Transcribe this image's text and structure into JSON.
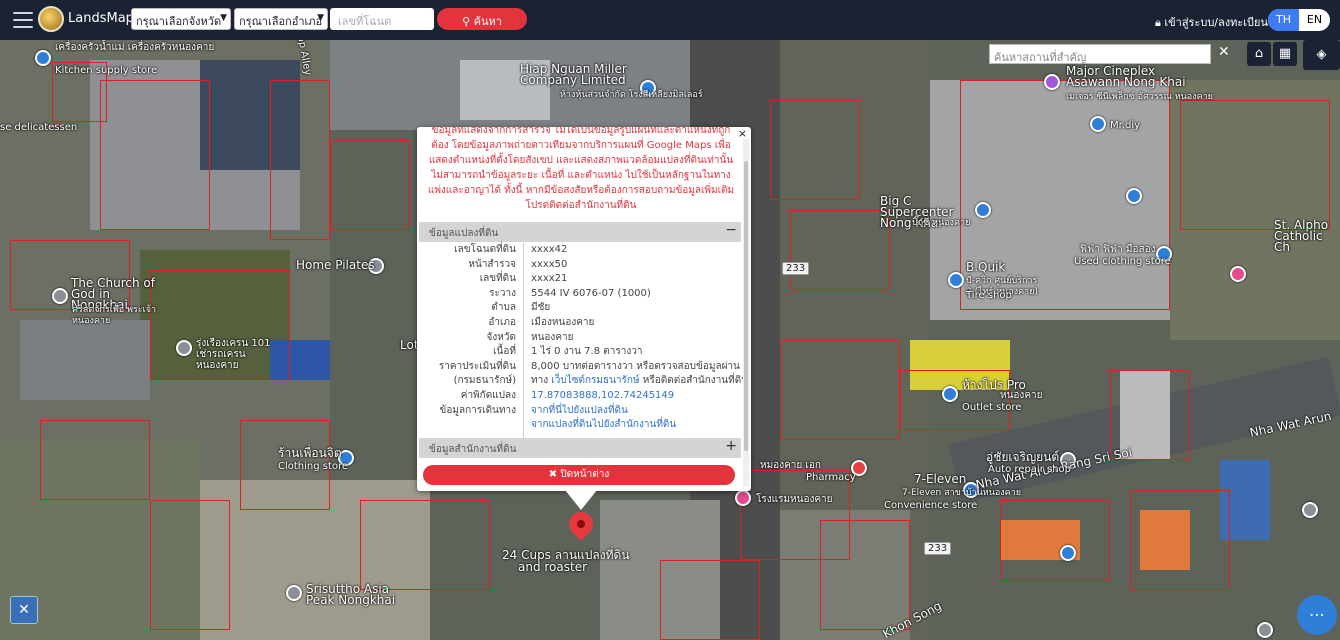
{
  "topbar": {
    "app_name": "LandsMaps",
    "province_select": "กรุณาเลือกจังหวัด",
    "district_select": "กรุณาเลือกอำเภอ",
    "deed_placeholder": "เลขที่โฉนด",
    "search_label": "ค้นหา",
    "login_label": "เข้าสู่ระบบ/ลงทะเบียน",
    "lang_th": "TH",
    "lang_en": "EN"
  },
  "map": {
    "place_search_placeholder": "ค้นหาสถานที่สำคัญ",
    "road_numbers": [
      "233",
      "233"
    ],
    "labels": {
      "kitchen_th": "เครื่องครัวน้ำแม่ เครื่องครัวหนองคาย",
      "kitchen_en": "Kitchen supply store",
      "alley": "ap Alley",
      "hiap": "Hiap Nguan Miller Company Limited",
      "hiap_th": "ห้างหุ้นส่วนจำกัด โรงสีเหลียงมิลเลอร์",
      "major": "Major Cineplex Asawann Nong Khai",
      "major_th": "เมเจอร์ ซีนีเพล็กซ์ อัศวรรณ หนองคาย",
      "mrdiy": "Mr.diy",
      "delicatessen": "se delicatessen",
      "bigc": "Big C Supercenter Nong Khai",
      "bigc_th": "บิ๊กซี หนองคาย",
      "church": "The Church of God in Nongkhai",
      "church_th": "คริสตจักรเพื่อ พระเจ้าหนองคาย",
      "homepilates": "Home Pilates",
      "sign": "รุ่งเรืองเครน 101 เช่ารถเครนหนองคาย",
      "lotus": "Lot",
      "sialpo": "St. Alpho Catholic Ch",
      "clothing": "ฟิฟ่า ฟิฟ่า มือสอง",
      "clothing_en": "Used clothing store",
      "bquik": "B.Quik",
      "bquik_th": "บี-ควิก ศูนย์บริการ 2 (ไทร์ หนองคาย)",
      "bquik_en": "Tire shop",
      "pro": "ห้างโปร Pro",
      "pro_th": "หนองคาย",
      "pro_en": "Outlet store",
      "shop_left": "ร้านเพื่อนจิต",
      "shop_left_en": "Clothing store",
      "pharmacy": "Pharmacy",
      "pharmacy_th": "หมองคาย เอก",
      "elev": "7-Eleven",
      "elev_th": "7-Eleven สาขาบ้านหนองคาย",
      "elev_en": "Convenience store",
      "nha_wat": "Nha Wat Arun Rang Sri Soi",
      "nha_wat2": "Nha Wat Arun",
      "auto": "อู่ชัยเจริญยนต์",
      "auto_en": "Auto repair shop",
      "cafe": "24 Cups ลานแปลงที่ดิน",
      "cafe_en": "and roaster",
      "srisuttho": "Srisuttho Asia Peak Nongkhai",
      "khon": "Khon Song",
      "bottom_mid": "โรงแรมหนองคาย"
    }
  },
  "popup": {
    "disclaimer": "ข้อมูลที่แสดงจากการสำรวจ ไม่ได้เป็นข้อมูลรูปแผนที่และตำแหน่งที่ถูกต้อง โดยข้อมูลภาพถ่ายดาวเทียมจากบริการแผนที่ Google Maps เพื่อแสดงตำแหน่งที่ตั้งโดยสังเขป และแสดงสภาพแวดล้อมแปลงที่ดินเท่านั้น ไม่สามารถนำข้อมูลระยะ เนื้อที่ และตำแหน่ง ไปใช้เป็นหลักฐานในทางแพ่งและอาญาได้ ทั้งนี้ หากมีข้อสงสัยหรือต้องการสอบถามข้อมูลเพิ่มเติม โปรดติดต่อสำนักงานที่ดิน",
    "section_parcel": "ข้อมูลแปลงที่ดิน",
    "section_parcel_sign": "−",
    "section_office": "ข้อมูลสำนักงานที่ดิน",
    "section_office_sign": "+",
    "rows": [
      {
        "label": "เลขโฉนดที่ดิน",
        "value": "xxxx42"
      },
      {
        "label": "หน้าสำรวจ",
        "value": "xxxx50"
      },
      {
        "label": "เลขที่ดิน",
        "value": "xxxx21"
      },
      {
        "label": "ระวาง",
        "value": "5544 IV 6076-07 (1000)"
      },
      {
        "label": "ตำบล",
        "value": "มีชัย"
      },
      {
        "label": "อำเภอ",
        "value": "เมืองหนองคาย"
      },
      {
        "label": "จังหวัด",
        "value": "หนองคาย"
      },
      {
        "label": "เนื้อที่",
        "value": "1 ไร่ 0 งาน 7.8 ตารางวา"
      },
      {
        "label": "ราคาประเมินที่ดิน",
        "value": "8,000 บาทต่อตารางวา หรือตรวจสอบข้อมูลผ่าน"
      },
      {
        "label": "(กรมธนารักษ์)",
        "value_prefix": "ทาง ",
        "value_link": "เว็บไซต์กรมธนารักษ์",
        "value_suffix": " หรือติดต่อสำนักงานที่ดิน"
      },
      {
        "label": "ค่าพิกัดแปลง",
        "value": "17.87083888,102.74245149"
      },
      {
        "label": "ข้อมูลการเดินทาง",
        "value": "จากที่นี่ไปยังแปลงที่ดิน"
      },
      {
        "label": "",
        "value": "จากแปลงที่ดินไปยังสำนักงานที่ดิน"
      }
    ],
    "close_label": "✖ ปิดหน้าต่าง",
    "x": "×"
  },
  "colors": {
    "topbar": "#1a2234",
    "accent_red": "#e2343c",
    "link_blue": "#2f72c9",
    "lang_active": "#3d7cf2"
  }
}
